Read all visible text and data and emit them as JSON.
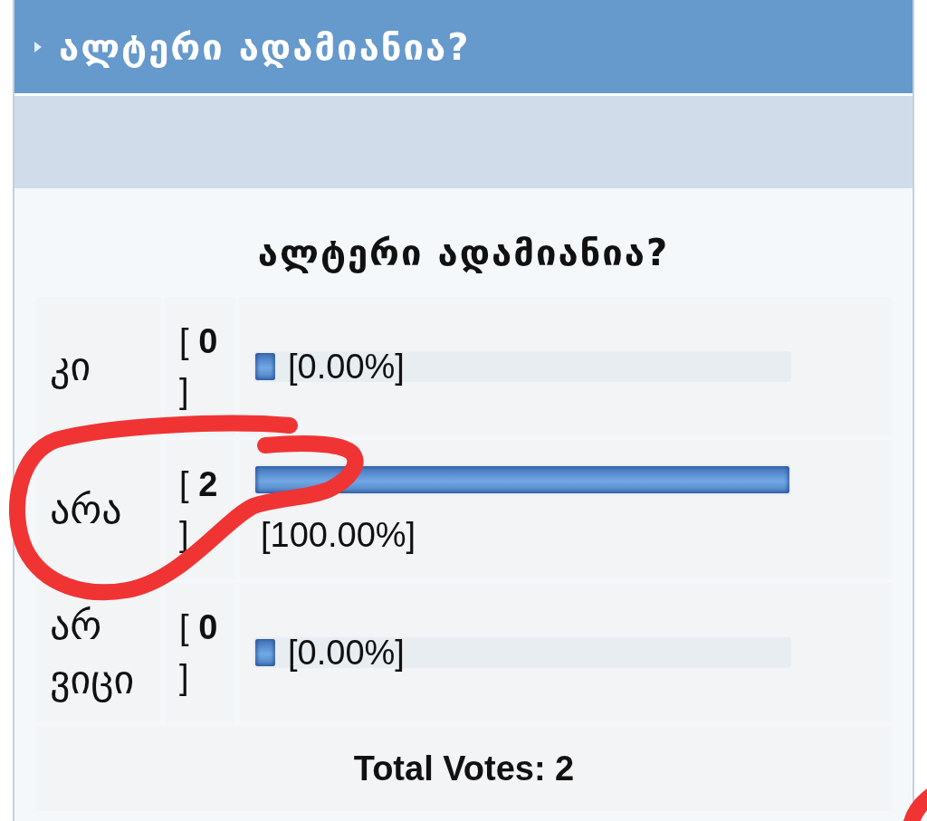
{
  "header": {
    "title": "ალტერი ადამიანია?"
  },
  "poll": {
    "question": "ალტერი ადამიანია?",
    "options": [
      {
        "label": "კი",
        "votes": "[ **0** ]",
        "level": 0,
        "percent": "[0.00%]",
        "circled": false
      },
      {
        "label": "არა",
        "votes": "[ **2** ]",
        "level": 1,
        "percent": "[100.00%]",
        "circled": true
      },
      {
        "label": "არ ვიცი",
        "votes": "[ **0** ]",
        "level": 0,
        "percent": "[0.00%]",
        "circled": false
      }
    ],
    "total": "Total Votes: 2"
  },
  "annotations": {
    "corner_stroke": true
  }
}
